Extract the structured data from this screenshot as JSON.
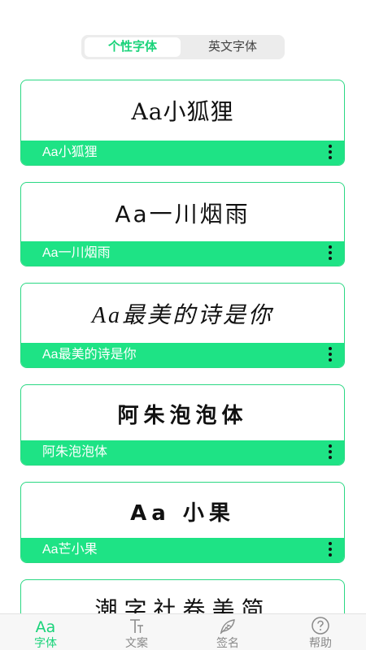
{
  "top_tabs": [
    {
      "label": "个性字体",
      "active": true
    },
    {
      "label": "英文字体",
      "active": false
    }
  ],
  "font_cards": [
    {
      "preview": "Aa小狐狸",
      "name": "Aa小狐狸"
    },
    {
      "preview": "Aa一川烟雨",
      "name": "Aa一川烟雨"
    },
    {
      "preview": "Aa最美的诗是你",
      "name": "Aa最美的诗是你"
    },
    {
      "preview": "阿朱泡泡体",
      "name": "阿朱泡泡体"
    },
    {
      "preview": "Aa 小果",
      "name": "Aa芒小果"
    },
    {
      "preview": "潮字社卷美简",
      "name": ""
    }
  ],
  "bottom_nav": [
    {
      "label": "字体",
      "icon": "Aa",
      "active": true
    },
    {
      "label": "文案",
      "icon": "text-style-icon",
      "active": false
    },
    {
      "label": "签名",
      "icon": "feather-icon",
      "active": false
    },
    {
      "label": "帮助",
      "icon": "help-icon",
      "active": false
    }
  ],
  "colors": {
    "accent": "#1ad37a",
    "card_bar": "#1ee385",
    "card_border": "#2bd883"
  }
}
